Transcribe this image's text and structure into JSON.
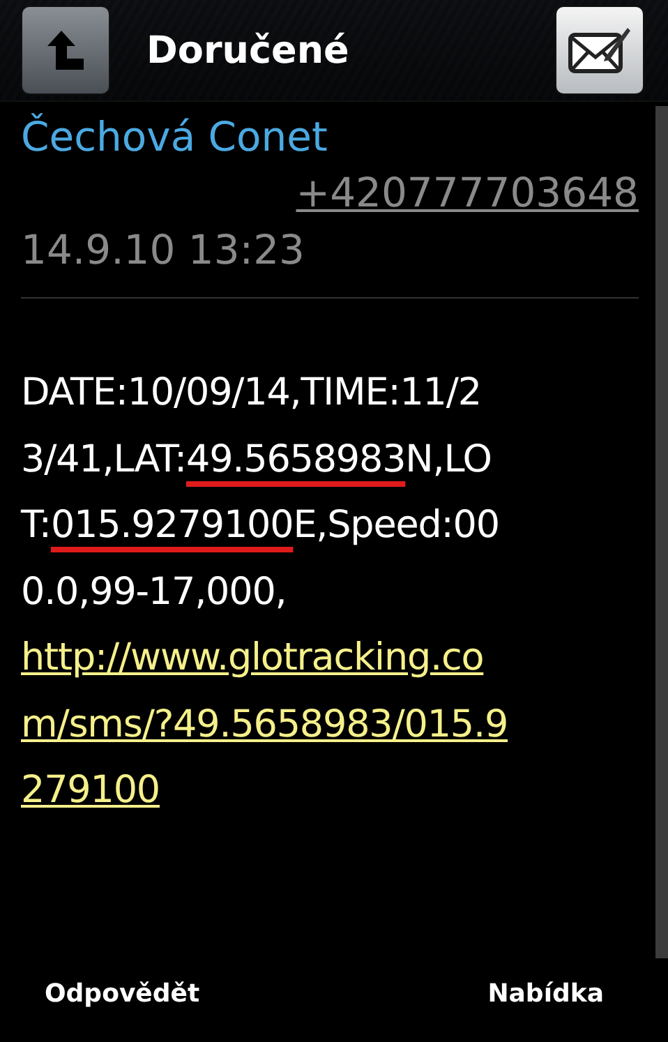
{
  "header": {
    "title": "Doručené"
  },
  "message": {
    "sender": "Čechová Conet",
    "phone": "+420777703648",
    "timestamp": "14.9.10 13:23",
    "body_lines": [
      [
        {
          "kind": "text",
          "text": "DATE:10/09/14,TIME:11/2"
        }
      ],
      [
        {
          "kind": "text",
          "text": "3/41,LAT:"
        },
        {
          "kind": "marked",
          "text": "49.5658983"
        },
        {
          "kind": "text",
          "text": "N,LO"
        }
      ],
      [
        {
          "kind": "text",
          "text": "T:"
        },
        {
          "kind": "marked",
          "text": "015.9279100"
        },
        {
          "kind": "text",
          "text": "E,Speed:00"
        }
      ],
      [
        {
          "kind": "text",
          "text": "0.0,99-17,000,"
        }
      ],
      [
        {
          "kind": "link",
          "text": "http://www.glotracking.co"
        }
      ],
      [
        {
          "kind": "link",
          "text": "m/sms/?49.5658983/015.9"
        }
      ],
      [
        {
          "kind": "link",
          "text": "279100"
        }
      ]
    ]
  },
  "softkeys": {
    "left": "Odpovědět",
    "right": "Nabídka"
  }
}
